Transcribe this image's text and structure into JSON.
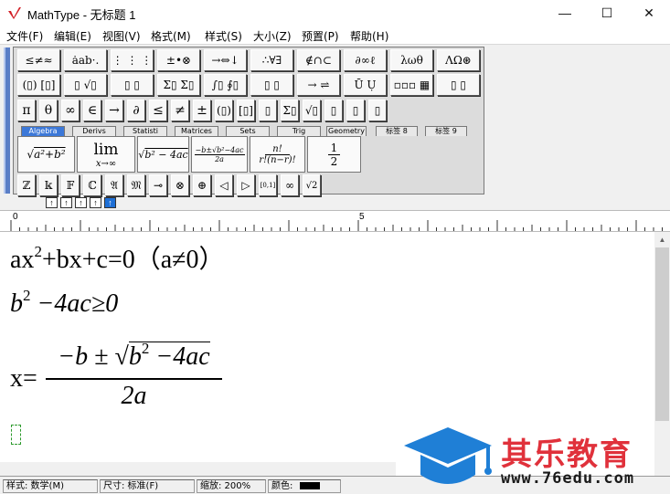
{
  "window": {
    "title": "MathType - 无标题 1",
    "controls": {
      "minimize": "—",
      "maximize": "☐",
      "close": "✕"
    }
  },
  "menu": [
    "文件(F)",
    "编辑(E)",
    "视图(V)",
    "格式(M)",
    "样式(S)",
    "大小(Z)",
    "预置(P)",
    "帮助(H)"
  ],
  "toolbar": {
    "row1": [
      "≤≠≈",
      "ȧab·.",
      "⋮ ⋮ ⋮",
      "±•⊗",
      "→⇔↓",
      "∴∀∃",
      "∉∩⊂",
      "∂∞ℓ",
      "λωθ",
      "ΛΩ⊛"
    ],
    "row2": [
      "(▯) [▯]",
      "▯ √▯",
      "▯ ▯",
      "Σ▯ Σ▯",
      "∫▯ ∮▯",
      "▯ ▯",
      "→ ⇌",
      "Ū Ụ",
      "▫▫▫ ▦",
      "▯ ▯"
    ],
    "row3": [
      "π",
      "θ",
      "∞",
      "∈",
      "→",
      "∂",
      "≤",
      "≠",
      "±",
      "(▯)",
      "[▯]",
      "▯",
      "Σ▯",
      "√▯",
      "▯",
      "▯",
      "▯"
    ],
    "tabs": [
      "Algebra",
      "Derivs",
      "Statisti",
      "Matrices",
      "Sets",
      "Trig",
      "Geometry",
      "标签 8",
      "标签 9"
    ],
    "active_tab": "Algebra",
    "templates": [
      "√(a²+b²)",
      "lim x→∞",
      "√(b²−4ac)",
      "(−b±√(b²−4ac))/2a",
      "n!/r!(n−r)!",
      "1/2"
    ],
    "row5": [
      "ℤ",
      "𝕜",
      "𝔽",
      "ℂ",
      "𝔄",
      "𝔐",
      "⊸",
      "⊗",
      "⊕",
      "◁",
      "▷",
      "[0,1]",
      "∞",
      "√2"
    ],
    "small_buttons": [
      "↑",
      "↑",
      "↑",
      "↑",
      "↑"
    ]
  },
  "ruler": {
    "marks": [
      "0",
      "5"
    ]
  },
  "equations": {
    "eq1": {
      "lhs": "ax",
      "exp": "2",
      "rest": "+bx+c=0（a≠0）"
    },
    "eq2": {
      "b": "b",
      "exp": "2",
      "rest": " −4ac≥0"
    },
    "eq3": {
      "lhs": "x=",
      "num": "−b ± √",
      "rad": "b",
      "radexp": "2",
      "radrest": " −4ac",
      "den": "2a"
    }
  },
  "status": {
    "style": "样式: 数学(M)",
    "size": "尺寸: 标准(F)",
    "zoom": "缩放: 200%",
    "color": "颜色:"
  },
  "watermark": {
    "brand": "其乐教育",
    "url": "www.76edu.com"
  },
  "colors": {
    "accent": "#3c78d8",
    "watermark_red": "#e0313b",
    "watermark_blue": "#1f7fd6"
  }
}
